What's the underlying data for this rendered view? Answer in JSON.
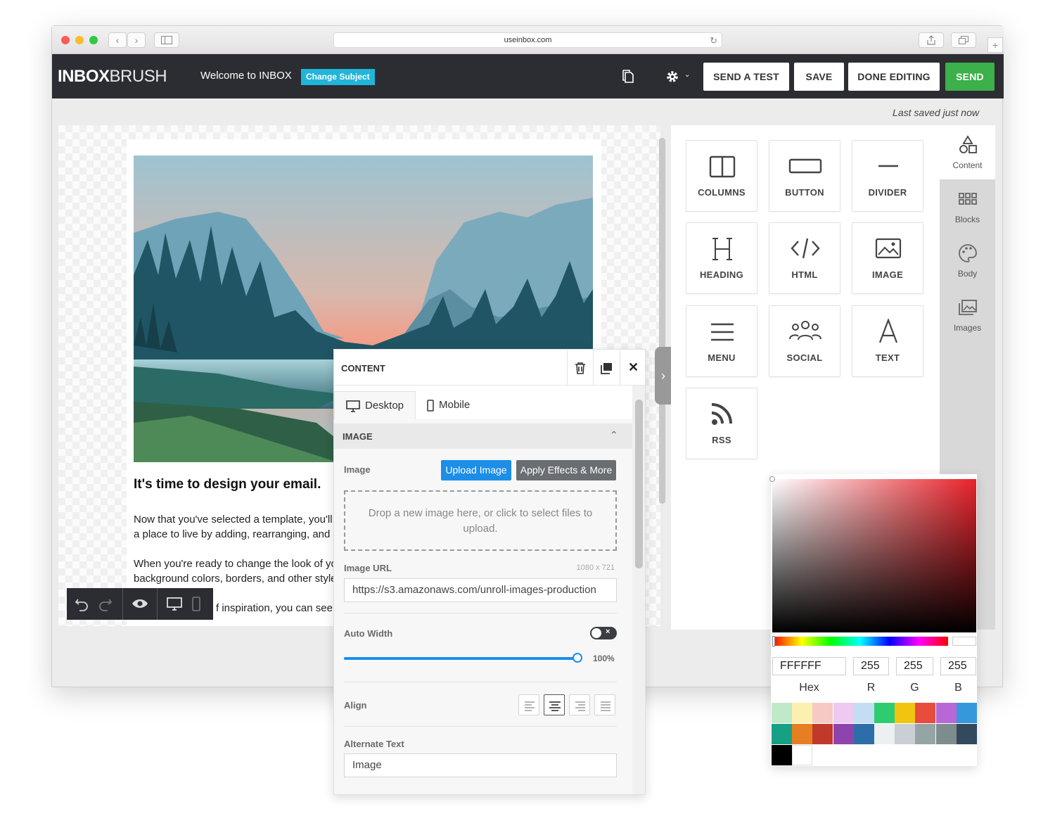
{
  "browser": {
    "url": "useinbox.com"
  },
  "header": {
    "logo_bold": "INB",
    "logo_o": "O",
    "logo_x": "X",
    "logo_light": "BRUSH",
    "subject": "Welcome to INBOX",
    "change_subject": "Change Subject",
    "send_test": "SEND A TEST",
    "save": "SAVE",
    "done_editing": "DONE EDITING",
    "send": "SEND",
    "accent_color": "#21b5d9",
    "send_color": "#3cb04a"
  },
  "status": {
    "last_saved": "Last saved just now"
  },
  "email": {
    "heading": "It's time to design your email.",
    "lines": [
      "Now that you've selected a template, you'll d",
      "a place to live by adding, rearranging, and d",
      "When you're ready to change the look of yo",
      "background colors, borders, and other style",
      "f inspiration, you can see"
    ]
  },
  "content_tiles": [
    {
      "label": "COLUMNS",
      "icon": "columns-icon"
    },
    {
      "label": "BUTTON",
      "icon": "button-icon"
    },
    {
      "label": "DIVIDER",
      "icon": "divider-icon"
    },
    {
      "label": "HEADING",
      "icon": "heading-icon"
    },
    {
      "label": "HTML",
      "icon": "code-icon"
    },
    {
      "label": "IMAGE",
      "icon": "image-icon"
    },
    {
      "label": "MENU",
      "icon": "menu-icon"
    },
    {
      "label": "SOCIAL",
      "icon": "social-icon"
    },
    {
      "label": "TEXT",
      "icon": "text-icon"
    },
    {
      "label": "RSS",
      "icon": "rss-icon"
    }
  ],
  "side_tabs": [
    {
      "label": "Content",
      "icon": "shapes-icon",
      "active": true
    },
    {
      "label": "Blocks",
      "icon": "grid-icon",
      "active": false
    },
    {
      "label": "Body",
      "icon": "palette-icon",
      "active": false
    },
    {
      "label": "Images",
      "icon": "images-icon",
      "active": false
    }
  ],
  "props": {
    "title": "CONTENT",
    "tab_desktop": "Desktop",
    "tab_mobile": "Mobile",
    "section": "IMAGE",
    "image_label": "Image",
    "upload_button": "Upload Image",
    "effects_button": "Apply Effects & More",
    "dropzone_text": "Drop a new image here, or click to select files to upload.",
    "url_label": "Image URL",
    "image_size": "1080 x 721",
    "url_value": "https://s3.amazonaws.com/unroll-images-production",
    "auto_width_label": "Auto Width",
    "auto_width_on": false,
    "width_percent_label": "100%",
    "width_fraction": 1.0,
    "align_label": "Align",
    "align_selected": "center",
    "alt_label": "Alternate Text",
    "alt_value": "Image",
    "upload_color": "#1c8ee8",
    "effects_color": "#6a6d72"
  },
  "color_picker": {
    "hex": "FFFFFF",
    "r": "255",
    "g": "255",
    "b": "255",
    "hex_label": "Hex",
    "r_label": "R",
    "g_label": "G",
    "b_label": "B",
    "swatches_row1": [
      "#bfe9c9",
      "#fcf0b1",
      "#f7c9c4",
      "#eec9f2",
      "#c3def2",
      "#2ecc71",
      "#f1c40f",
      "#e74c3c",
      "#b767d6",
      "#3498db"
    ],
    "swatches_row2": [
      "#16a085",
      "#e67e22",
      "#c0392b",
      "#8e44ad",
      "#2c6fa8",
      "#ecf0f1",
      "#c9cfd4",
      "#95a5a6",
      "#7f8c8d",
      "#34495e"
    ],
    "swatches_row3": [
      "#000000",
      "#ffffff"
    ]
  }
}
